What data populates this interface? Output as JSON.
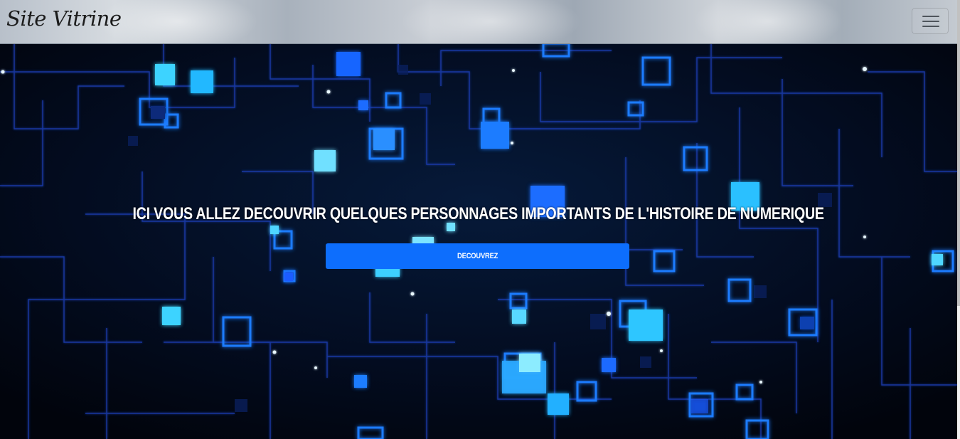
{
  "navbar": {
    "brand": "Site Vitrine",
    "menu_icon": "hamburger-menu-icon"
  },
  "hero": {
    "title": "ICI VOUS ALLEZ DECOUVRIR QUELQUES PERSONNAGES IMPORTANTS DE L'HISTOIRE DE NUMERIQUE",
    "cta_label": "DECOUVREZ",
    "background": "digital-circuit-network-image"
  },
  "colors": {
    "accent": "#0d6efd",
    "hero_bg": "#020814",
    "glow": "#1aa8ff",
    "title_text": "#ffffff"
  }
}
